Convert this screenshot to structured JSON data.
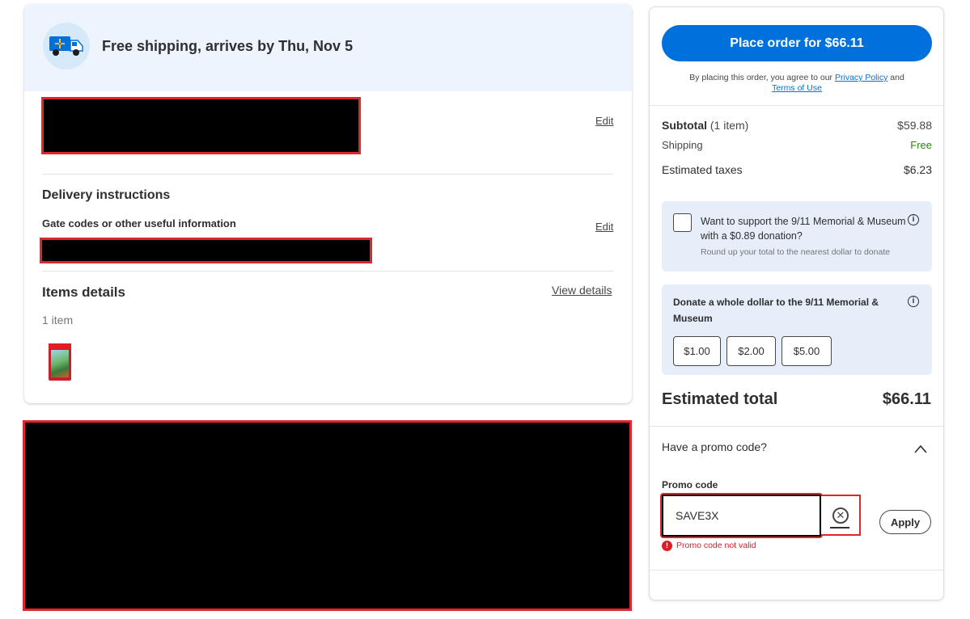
{
  "shipping": {
    "banner_text": "Free shipping, arrives by Thu, Nov 5",
    "edit_label": "Edit"
  },
  "delivery": {
    "title": "Delivery instructions",
    "subtitle": "Gate codes or other useful information",
    "edit_label": "Edit"
  },
  "items": {
    "title": "Items details",
    "count_text": "1 item",
    "view_details": "View details"
  },
  "order": {
    "place_button": "Place order for $66.11",
    "agree_prefix": "By placing this order, you agree to our",
    "privacy_link": "Privacy Policy",
    "agree_and": "and",
    "terms_link": "Terms of Use"
  },
  "summary": {
    "subtotal_label": "Subtotal",
    "subtotal_count": "(1 item)",
    "subtotal_value": "$59.88",
    "shipping_label": "Shipping",
    "shipping_value": "Free",
    "taxes_label": "Estimated taxes",
    "taxes_value": "$6.23",
    "total_label": "Estimated total",
    "total_value": "$66.11"
  },
  "roundup": {
    "text": "Want to support the 9/11 Memorial & Museum with a $0.89 donation?",
    "subtext": "Round up your total to the nearest dollar to donate"
  },
  "donate": {
    "title": "Donate a whole dollar to the 9/11 Memorial & Museum",
    "amounts": [
      "$1.00",
      "$2.00",
      "$5.00"
    ]
  },
  "promo": {
    "question": "Have a promo code?",
    "label": "Promo code",
    "value": "SAVE3X",
    "apply_label": "Apply",
    "error": "Promo code not valid"
  },
  "colors": {
    "primary_blue": "#0071dc",
    "error_red": "#de1c24",
    "free_green": "#2a8703",
    "banner_bg": "#eef4fd"
  }
}
